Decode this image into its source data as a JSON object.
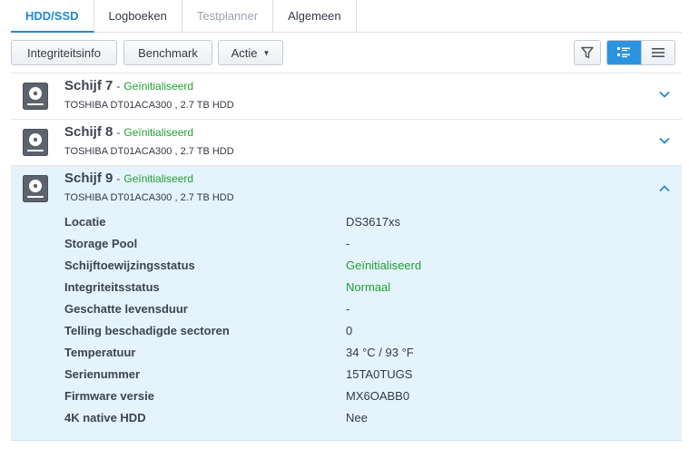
{
  "tabs": [
    {
      "label": "HDD/SSD",
      "state": "active"
    },
    {
      "label": "Logboeken",
      "state": "normal"
    },
    {
      "label": "Testplanner",
      "state": "disabled"
    },
    {
      "label": "Algemeen",
      "state": "normal"
    }
  ],
  "toolbar": {
    "integrity_label": "Integriteitsinfo",
    "benchmark_label": "Benchmark",
    "action_label": "Actie"
  },
  "disks": [
    {
      "name": "Schijf 7",
      "dash": "-",
      "status": "Geïnitialiseerd",
      "model": "TOSHIBA DT01ACA300 , 2.7 TB HDD"
    },
    {
      "name": "Schijf 8",
      "dash": "-",
      "status": "Geïnitialiseerd",
      "model": "TOSHIBA DT01ACA300 , 2.7 TB HDD"
    },
    {
      "name": "Schijf 9",
      "dash": "-",
      "status": "Geïnitialiseerd",
      "model": "TOSHIBA DT01ACA300 , 2.7 TB HDD"
    }
  ],
  "details": [
    {
      "label": "Locatie",
      "value": "DS3617xs"
    },
    {
      "label": "Storage Pool",
      "value": "-"
    },
    {
      "label": "Schijftoewijzingsstatus",
      "value": "Geïnitialiseerd"
    },
    {
      "label": "Integriteitsstatus",
      "value": "Normaal"
    },
    {
      "label": "Geschatte levensduur",
      "value": "-"
    },
    {
      "label": "Telling beschadigde sectoren",
      "value": "0"
    },
    {
      "label": "Temperatuur",
      "value": "34 °C / 93 °F"
    },
    {
      "label": "Serienummer",
      "value": "15TA0TUGS"
    },
    {
      "label": "Firmware versie",
      "value": "MX6OABB0"
    },
    {
      "label": "4K native HDD",
      "value": "Nee"
    }
  ],
  "colors": {
    "accent": "#1e88d9",
    "status_green": "#20a030",
    "expanded_bg": "#e5f3fc"
  },
  "icons": {
    "filter": "filter-icon",
    "list_detail": "detail-list-icon",
    "list_simple": "simple-list-icon",
    "disk": "hdd-icon",
    "expand": "chevron-down-icon",
    "collapse": "chevron-up-icon"
  }
}
